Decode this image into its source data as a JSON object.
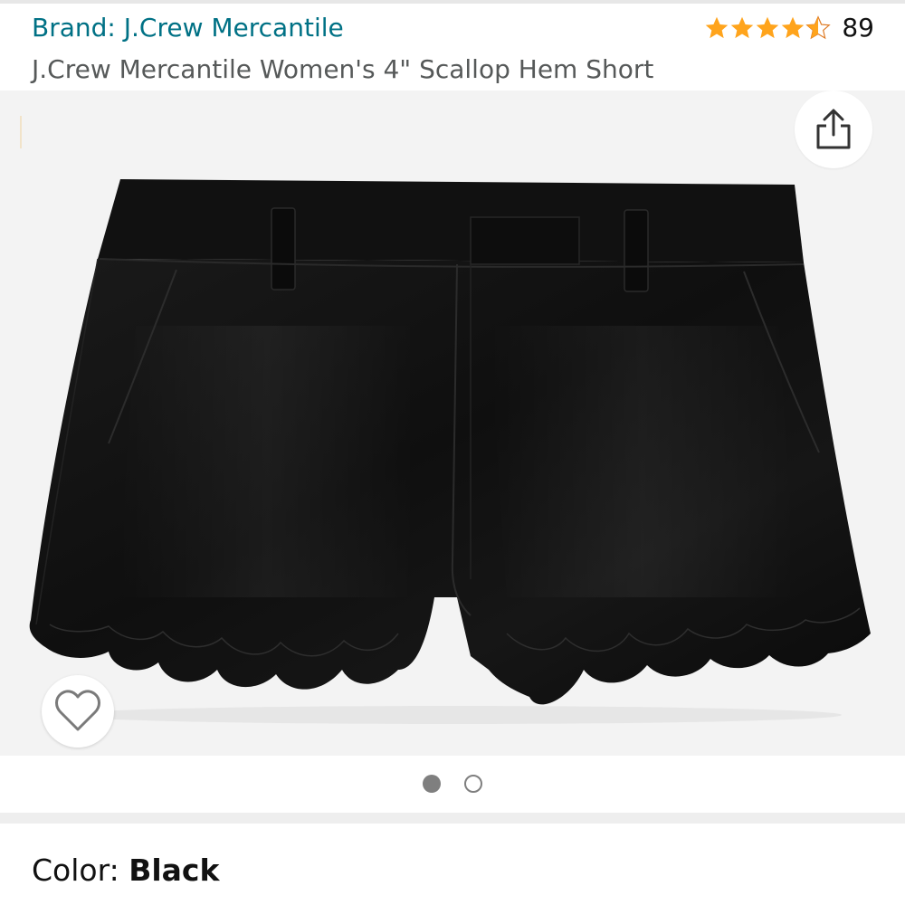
{
  "header": {
    "brand_prefix": "Brand:",
    "brand_name": "J.Crew Mercantile",
    "product_title": "J.Crew Mercantile Women's 4\" Scallop Hem Short",
    "rating": {
      "stars": 4.5,
      "count": "89",
      "star_color": "#ffa41c"
    }
  },
  "gallery": {
    "image_name": "black-scallop-hem-shorts",
    "background_color": "#f3f3f3",
    "share_icon": "share-icon",
    "wishlist_icon": "heart-outline-icon",
    "image_count": 2,
    "active_index": 0
  },
  "variation": {
    "color_label": "Color:",
    "color_value": "Black"
  },
  "theme": {
    "link_color": "#007185",
    "text_secondary": "#565959"
  }
}
